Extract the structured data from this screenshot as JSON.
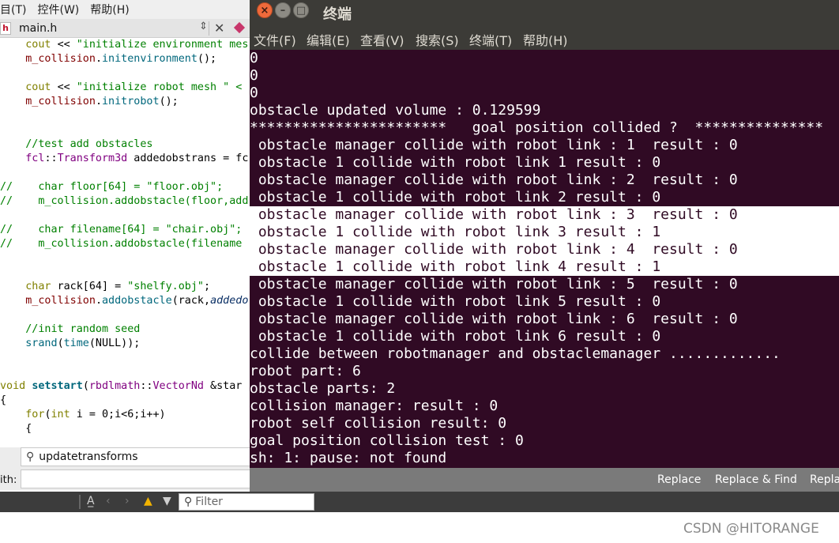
{
  "ide": {
    "menu": [
      "目(T)",
      "控件(W)",
      "帮助(H)"
    ],
    "file_icon": "h",
    "file_tab": "main.h",
    "code_lines": [
      {
        "segs": [
          [
            "kw",
            "    cout "
          ],
          [
            "",
            "<< "
          ],
          [
            "str",
            "\"initialize environment mes"
          ]
        ]
      },
      {
        "segs": [
          [
            "mem",
            "    m_collision"
          ],
          [
            "",
            "."
          ],
          [
            "fn",
            "initenvironment"
          ],
          [
            "",
            "();"
          ]
        ]
      },
      {
        "segs": [
          [
            "",
            ""
          ]
        ]
      },
      {
        "segs": [
          [
            "kw",
            "    cout "
          ],
          [
            "",
            "<< "
          ],
          [
            "str",
            "\"initialize robot mesh \" <"
          ]
        ]
      },
      {
        "segs": [
          [
            "mem",
            "    m_collision"
          ],
          [
            "",
            "."
          ],
          [
            "fn",
            "initrobot"
          ],
          [
            "",
            "();"
          ]
        ]
      },
      {
        "segs": [
          [
            "",
            ""
          ]
        ]
      },
      {
        "segs": [
          [
            "",
            ""
          ]
        ]
      },
      {
        "segs": [
          [
            "cm",
            "    //test add obstacles"
          ]
        ]
      },
      {
        "segs": [
          [
            "ty",
            "    fcl"
          ],
          [
            "",
            "::"
          ],
          [
            "ty",
            "Transform3d"
          ],
          [
            "",
            " addedobstrans = fc"
          ]
        ]
      },
      {
        "segs": [
          [
            "",
            ""
          ]
        ]
      },
      {
        "segs": [
          [
            "cm",
            "//    char floor[64] = \"floor.obj\";"
          ]
        ]
      },
      {
        "segs": [
          [
            "cm",
            "//    m_collision.addobstacle(floor,add"
          ]
        ]
      },
      {
        "segs": [
          [
            "",
            ""
          ]
        ]
      },
      {
        "segs": [
          [
            "cm",
            "//    char filename[64] = \"chair.obj\";"
          ]
        ]
      },
      {
        "segs": [
          [
            "cm",
            "//    m_collision.addobstacle(filename"
          ]
        ]
      },
      {
        "segs": [
          [
            "",
            ""
          ]
        ]
      },
      {
        "segs": [
          [
            "",
            ""
          ]
        ]
      },
      {
        "segs": [
          [
            "kw",
            "    char "
          ],
          [
            "",
            "rack[64] = "
          ],
          [
            "str",
            "\"shelfy.obj\""
          ],
          [
            "",
            ";"
          ]
        ]
      },
      {
        "segs": [
          [
            "mem",
            "    m_collision"
          ],
          [
            "",
            "."
          ],
          [
            "fn",
            "addobstacle"
          ],
          [
            "",
            "(rack,"
          ],
          [
            "it",
            "addedo"
          ]
        ]
      },
      {
        "segs": [
          [
            "",
            ""
          ]
        ]
      },
      {
        "segs": [
          [
            "cm",
            "    //init random seed"
          ]
        ]
      },
      {
        "segs": [
          [
            "fn",
            "    srand"
          ],
          [
            "",
            "("
          ],
          [
            "fn",
            "time"
          ],
          [
            "",
            "(NULL));"
          ]
        ]
      },
      {
        "segs": [
          [
            "",
            ""
          ]
        ]
      },
      {
        "segs": [
          [
            "",
            ""
          ]
        ]
      },
      {
        "segs": [
          [
            "kw",
            "void "
          ],
          [
            "bold",
            "setstart"
          ],
          [
            "",
            "("
          ],
          [
            "ty",
            "rbdlmath"
          ],
          [
            "",
            "::"
          ],
          [
            "ty",
            "VectorNd"
          ],
          [
            "",
            " &star"
          ]
        ]
      },
      {
        "segs": [
          [
            "",
            "{"
          ]
        ]
      },
      {
        "segs": [
          [
            "kw",
            "    for"
          ],
          [
            "",
            "("
          ],
          [
            "kw",
            "int"
          ],
          [
            "",
            " i = 0;i<6;i++)"
          ]
        ]
      },
      {
        "segs": [
          [
            "",
            "    {"
          ]
        ]
      }
    ],
    "find_value": "updatetransforms",
    "replace_label": "ith:",
    "replace_button": "Replace",
    "replace_find_button": "Replace & Find",
    "replace_all_button": "Repla",
    "filter_placeholder": "Filter"
  },
  "terminal": {
    "title": "终端",
    "menu": [
      "文件(F)",
      "编辑(E)",
      "查看(V)",
      "搜索(S)",
      "终端(T)",
      "帮助(H)"
    ],
    "lines": [
      "0",
      "0",
      "0",
      "obstacle updated volume : 0.129599",
      "***********************   goal position collided ?  ***************",
      " obstacle manager collide with robot link : 1  result : 0",
      " obstacle 1 collide with robot link 1 result : 0",
      " obstacle manager collide with robot link : 2  result : 0",
      " obstacle 1 collide with robot link 2 result : 0",
      " obstacle manager collide with robot link : 3  result : 0",
      " obstacle 1 collide with robot link 3 result : 1",
      " obstacle manager collide with robot link : 4  result : 0",
      " obstacle 1 collide with robot link 4 result : 1",
      " obstacle manager collide with robot link : 5  result : 0",
      " obstacle 1 collide with robot link 5 result : 0",
      " obstacle manager collide with robot link : 6  result : 0",
      " obstacle 1 collide with robot link 6 result : 0",
      "collide between robotmanager and obstaclemanager .............",
      "robot part: 6",
      "obstacle parts: 2",
      "collision manager: result : 0",
      "robot self collision result: 0",
      "goal position collision test : 0",
      "sh: 1: pause: not found"
    ],
    "selected_from": 9,
    "selected_to": 12
  },
  "watermark": "CSDN @HITORANGE"
}
